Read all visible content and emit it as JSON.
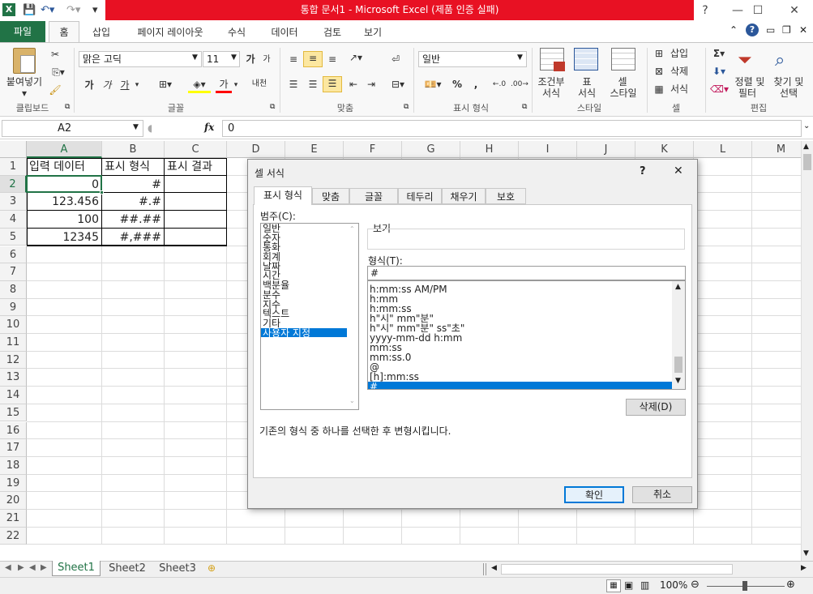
{
  "window": {
    "title": "통합 문서1  -  Microsoft Excel (제품 인증 실패)",
    "help": "?"
  },
  "tabs": {
    "file": "파일",
    "items": [
      "홈",
      "삽입",
      "페이지 레이아웃",
      "수식",
      "데이터",
      "검토",
      "보기"
    ]
  },
  "ribbon": {
    "clipboard": {
      "paste": "붙여넣기",
      "label": "클립보드"
    },
    "font": {
      "name": "맑은 고딕",
      "size": "11",
      "grow": "가",
      "shrink": "가",
      "bold": "가",
      "italic": "가",
      "underline": "가",
      "fontcolor": "가",
      "phonetic": "내천",
      "label": "글꼴"
    },
    "align": {
      "label": "맞춤"
    },
    "number": {
      "format": "일반",
      "percent": "%",
      "comma": ",",
      "label": "표시 형식"
    },
    "styles": {
      "cond": [
        "조건부",
        "서식"
      ],
      "table": [
        "표",
        "서식"
      ],
      "cell": [
        "셀",
        "스타일"
      ],
      "label": "스타일"
    },
    "cells": {
      "insert": "삽입",
      "delete": "삭제",
      "format": "서식",
      "label": "셀"
    },
    "edit": {
      "sort": [
        "정렬 및",
        "필터"
      ],
      "find": [
        "찾기 및",
        "선택"
      ],
      "label": "편집"
    }
  },
  "formula_bar": {
    "name_box": "A2",
    "fx": "fx",
    "value": "0"
  },
  "grid": {
    "columns": [
      "A",
      "B",
      "C",
      "D",
      "E",
      "F",
      "G",
      "H",
      "I",
      "J",
      "K",
      "L",
      "M"
    ],
    "rows": [
      "1",
      "2",
      "3",
      "4",
      "5",
      "6",
      "7",
      "8",
      "9",
      "10",
      "11",
      "12",
      "13",
      "14",
      "15",
      "16",
      "17",
      "18",
      "19",
      "20",
      "21",
      "22"
    ],
    "cells": [
      {
        "a": "입력 데이터",
        "b": "표시 형식",
        "c": "표시 결과"
      },
      {
        "a": "0",
        "b": "#",
        "c": ""
      },
      {
        "a": "123.456",
        "b": "#.#",
        "c": ""
      },
      {
        "a": "100",
        "b": "##.##",
        "c": ""
      },
      {
        "a": "12345",
        "b": "#,###",
        "c": ""
      }
    ]
  },
  "sheets": {
    "tabs": [
      "Sheet1",
      "Sheet2",
      "Sheet3"
    ],
    "zoom": "100%"
  },
  "dialog": {
    "title": "셀 서식",
    "help": "?",
    "close": "✕",
    "tabs": [
      "표시 형식",
      "맞춤",
      "글꼴",
      "테두리",
      "채우기",
      "보호"
    ],
    "category_label": "범주(C):",
    "categories": [
      "일반",
      "숫자",
      "통화",
      "회계",
      "날짜",
      "시간",
      "백분율",
      "분수",
      "지수",
      "텍스트",
      "기타",
      "사용자 지정"
    ],
    "preview_label": "보기",
    "type_label": "형식(T):",
    "type_value": "#",
    "formats": [
      "h:mm:ss AM/PM",
      "h:mm",
      "h:mm:ss",
      "h\"시\" mm\"분\"",
      "h\"시\" mm\"분\" ss\"초\"",
      "yyyy-mm-dd h:mm",
      "mm:ss",
      "mm:ss.0",
      "@",
      "[h]:mm:ss",
      "#"
    ],
    "delete_button": "삭제(D)",
    "description": "기존의 형식 중 하나를 선택한 후 변형시킵니다.",
    "ok": "확인",
    "cancel": "취소"
  },
  "colors": {
    "excel_green": "#217346",
    "selection_blue": "#0078d7",
    "title_red": "#e81123"
  }
}
